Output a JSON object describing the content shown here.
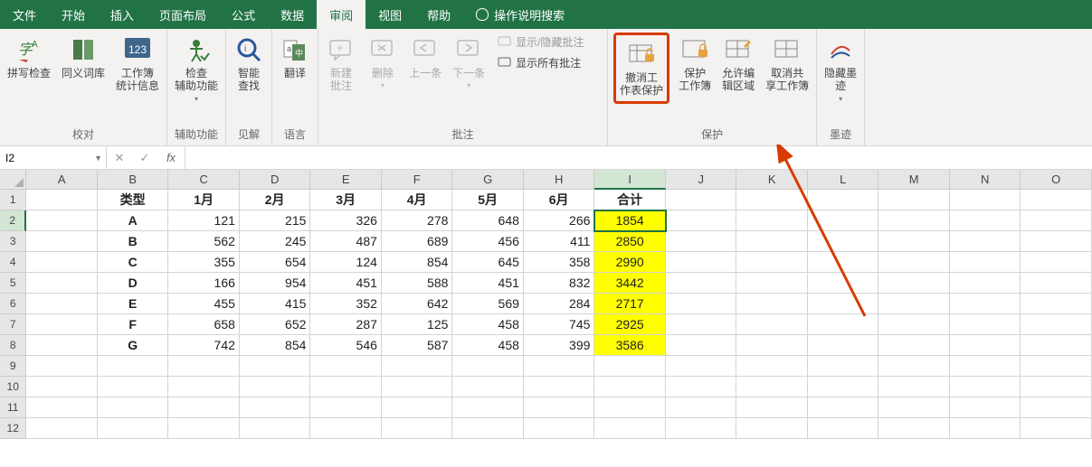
{
  "tabs": {
    "file": "文件",
    "home": "开始",
    "insert": "插入",
    "layout": "页面布局",
    "formulas": "公式",
    "data": "数据",
    "review": "审阅",
    "view": "视图",
    "help": "帮助",
    "tell": "操作说明搜索"
  },
  "ribbon": {
    "proofing": {
      "spell": "拼写检查",
      "thesaurus": "同义词库",
      "stats": "工作簿\n统计信息",
      "label": "校对"
    },
    "accessibility": {
      "check": "检查\n辅助功能",
      "label": "辅助功能"
    },
    "insights": {
      "smart": "智能\n查找",
      "label": "见解"
    },
    "language": {
      "translate": "翻译",
      "label": "语言"
    },
    "comments": {
      "new": "新建\n批注",
      "delete": "删除",
      "prev": "上一条",
      "next": "下一条",
      "showhide": "显示/隐藏批注",
      "showall": "显示所有批注",
      "label": "批注"
    },
    "protect": {
      "unprotect": "撤消工\n作表保护",
      "workbook": "保护\n工作簿",
      "ranges": "允许编\n辑区域",
      "share": "取消共\n享工作簿",
      "label": "保护"
    },
    "ink": {
      "hide": "隐藏墨\n迹",
      "label": "墨迹"
    }
  },
  "namebox": "I2",
  "grid": {
    "cols": [
      "A",
      "B",
      "C",
      "D",
      "E",
      "F",
      "G",
      "H",
      "I",
      "J",
      "K",
      "L",
      "M",
      "N",
      "O"
    ],
    "rows": [
      {
        "n": 1,
        "cells": [
          "",
          "类型",
          "1月",
          "2月",
          "3月",
          "4月",
          "5月",
          "6月",
          "合计",
          "",
          "",
          "",
          "",
          "",
          ""
        ],
        "bold": true
      },
      {
        "n": 2,
        "cells": [
          "",
          "A",
          "121",
          "215",
          "326",
          "278",
          "648",
          "266",
          "1854",
          "",
          "",
          "",
          "",
          "",
          ""
        ]
      },
      {
        "n": 3,
        "cells": [
          "",
          "B",
          "562",
          "245",
          "487",
          "689",
          "456",
          "411",
          "2850",
          "",
          "",
          "",
          "",
          "",
          ""
        ]
      },
      {
        "n": 4,
        "cells": [
          "",
          "C",
          "355",
          "654",
          "124",
          "854",
          "645",
          "358",
          "2990",
          "",
          "",
          "",
          "",
          "",
          ""
        ]
      },
      {
        "n": 5,
        "cells": [
          "",
          "D",
          "166",
          "954",
          "451",
          "588",
          "451",
          "832",
          "3442",
          "",
          "",
          "",
          "",
          "",
          ""
        ]
      },
      {
        "n": 6,
        "cells": [
          "",
          "E",
          "455",
          "415",
          "352",
          "642",
          "569",
          "284",
          "2717",
          "",
          "",
          "",
          "",
          "",
          ""
        ]
      },
      {
        "n": 7,
        "cells": [
          "",
          "F",
          "658",
          "652",
          "287",
          "125",
          "458",
          "745",
          "2925",
          "",
          "",
          "",
          "",
          "",
          ""
        ]
      },
      {
        "n": 8,
        "cells": [
          "",
          "G",
          "742",
          "854",
          "546",
          "587",
          "458",
          "399",
          "3586",
          "",
          "",
          "",
          "",
          "",
          ""
        ]
      },
      {
        "n": 9,
        "cells": [
          "",
          "",
          "",
          "",
          "",
          "",
          "",
          "",
          "",
          "",
          "",
          "",
          "",
          "",
          ""
        ]
      },
      {
        "n": 10,
        "cells": [
          "",
          "",
          "",
          "",
          "",
          "",
          "",
          "",
          "",
          "",
          "",
          "",
          "",
          "",
          ""
        ]
      },
      {
        "n": 11,
        "cells": [
          "",
          "",
          "",
          "",
          "",
          "",
          "",
          "",
          "",
          "",
          "",
          "",
          "",
          "",
          ""
        ]
      },
      {
        "n": 12,
        "cells": [
          "",
          "",
          "",
          "",
          "",
          "",
          "",
          "",
          "",
          "",
          "",
          "",
          "",
          "",
          ""
        ]
      }
    ]
  }
}
